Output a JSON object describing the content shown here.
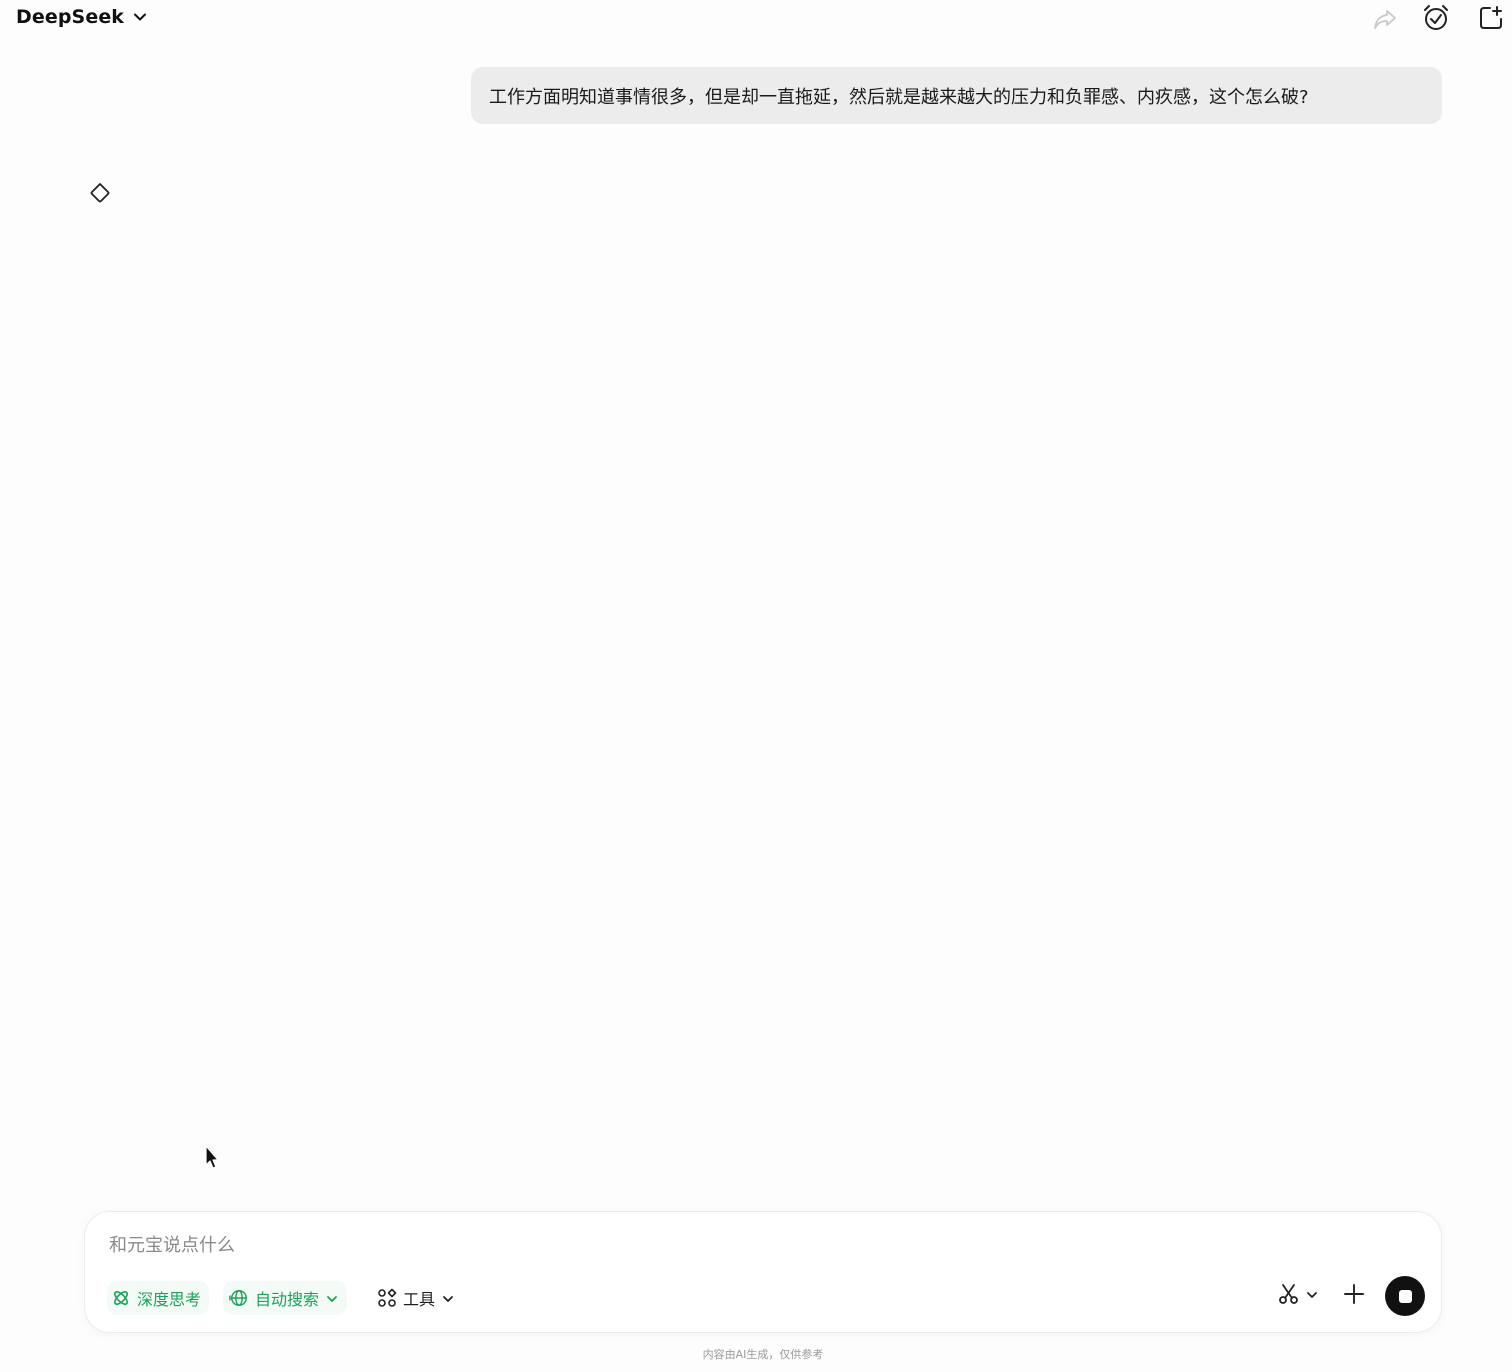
{
  "header": {
    "model_name": "DeepSeek",
    "icons": [
      "chevron-down-icon",
      "share-icon",
      "alarm-icon",
      "new-chat-icon"
    ]
  },
  "conversation": {
    "user_message": "工作方面明知道事情很多，但是却一直拖延，然后就是越来越大的压力和负罪感、内疚感，这个怎么破?",
    "assistant_state_icon": "loading-icon"
  },
  "composer": {
    "placeholder": "和元宝说点什么",
    "value": "",
    "deep_think_label": "深度思考",
    "auto_search_label": "自动搜索",
    "tools_label": "工具",
    "accent_color": "#1aa25a"
  },
  "footer": {
    "disclaimer": "内容由AI生成，仅供参考"
  }
}
